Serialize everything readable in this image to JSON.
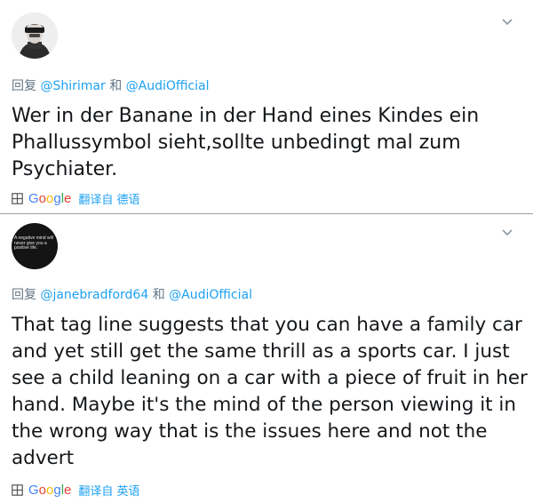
{
  "tweets": [
    {
      "reply_prefix": "回复",
      "reply_to_1": "@Shirimar",
      "reply_and": "和",
      "reply_to_2": "@AudiOfficial",
      "text": "Wer in der Banane in der Hand eines Kindes ein Phallussymbol sieht,sollte unbedingt mal zum Psychiater.",
      "translate_icon": "grid-icon",
      "translate_label": "翻译自 德语"
    },
    {
      "avatar_text": "A negative mind will never give you a positive life.",
      "reply_prefix": "回复",
      "reply_to_1": "@janebradford64",
      "reply_and": "和",
      "reply_to_2": "@AudiOfficial",
      "text": "That tag line suggests that you can have a family car and yet still get the same thrill as a sports car. I just see a child leaning on a car with a piece of fruit in her hand. Maybe it's the mind of the person viewing it in the wrong way that is the issues here and not the advert",
      "translate_icon": "grid-icon",
      "translate_label": "翻译自 英语"
    }
  ],
  "google_logo": {
    "letters": [
      "G",
      "o",
      "o",
      "g",
      "l",
      "e"
    ]
  },
  "colors": {
    "link": "#1da1f2",
    "muted": "#657786",
    "text": "#14171a"
  }
}
